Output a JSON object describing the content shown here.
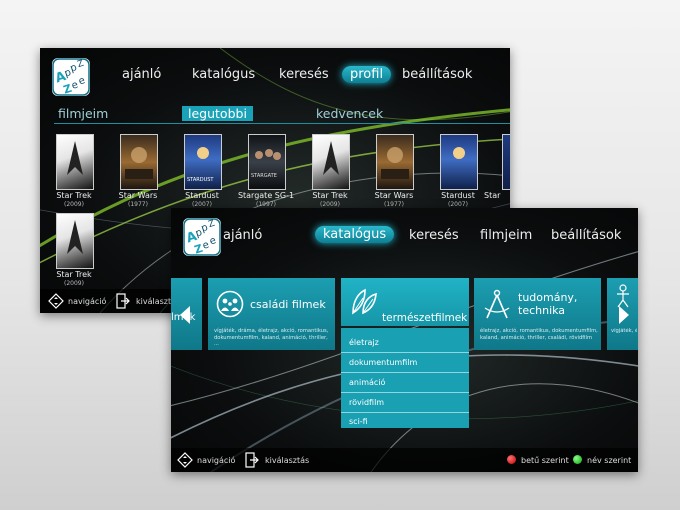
{
  "brand": {
    "logo_letters": [
      "A",
      "p",
      "p",
      "Z",
      "Z",
      "e",
      "e"
    ]
  },
  "screen1": {
    "nav": [
      "ajánló",
      "katalógus",
      "keresés",
      "profil",
      "beállítások"
    ],
    "active_nav": "profil",
    "tabs": [
      "filmjeim",
      "legutobbi",
      "kedvencek"
    ],
    "active_tab": "legutobbi",
    "movies": [
      {
        "title": "Star Trek",
        "year": "(2009)"
      },
      {
        "title": "Star Wars",
        "year": "(1977)"
      },
      {
        "title": "Stardust",
        "year": "(2007)"
      },
      {
        "title": "Stargate SG-1",
        "year": "(1997)"
      },
      {
        "title": "Star Trek",
        "year": "(2009)"
      },
      {
        "title": "Star Wars",
        "year": "(1977)"
      },
      {
        "title": "Stardust",
        "year": "(2007)"
      },
      {
        "title": "Star",
        "year": ""
      },
      {
        "title": "Star Trek",
        "year": "(2009)"
      }
    ],
    "footer": {
      "nav_label": "navigáció",
      "select_label": "kiválaszt"
    },
    "poster_labels": {
      "stardust": "STARDUST",
      "stargate": "STARGATE"
    }
  },
  "screen2": {
    "nav": [
      "ajánló",
      "katalógus",
      "keresés",
      "filmjeim",
      "beállítások"
    ],
    "active_nav": "katalógus",
    "categories": [
      {
        "name": "lmek",
        "desc": ""
      },
      {
        "name": "családi filmek",
        "desc": "vígjáték, dráma, életrajz, akció, romantikus, dokumentumfilm, kaland, animáció, thriller, ..."
      },
      {
        "name": "természetfilmek",
        "desc": ""
      },
      {
        "name": "tudomány, technika",
        "desc": "életrajz, akció, romantikus, dokumentumfilm, kaland, animáció, thriller, családi, rövidfilm"
      },
      {
        "name": "",
        "desc": "vígjáték, életr... dokumentumf..."
      }
    ],
    "dropdown": [
      "életrajz",
      "dokumentumfilm",
      "animáció",
      "rövidfilm",
      "sci-fi"
    ],
    "footer": {
      "nav_label": "navigáció",
      "select_label": "kiválasztás",
      "red_label": "betű szerint",
      "green_label": "név szerint"
    }
  },
  "colors": {
    "accent": "#1aa3b8",
    "red": "#e01010",
    "green": "#22c022"
  }
}
